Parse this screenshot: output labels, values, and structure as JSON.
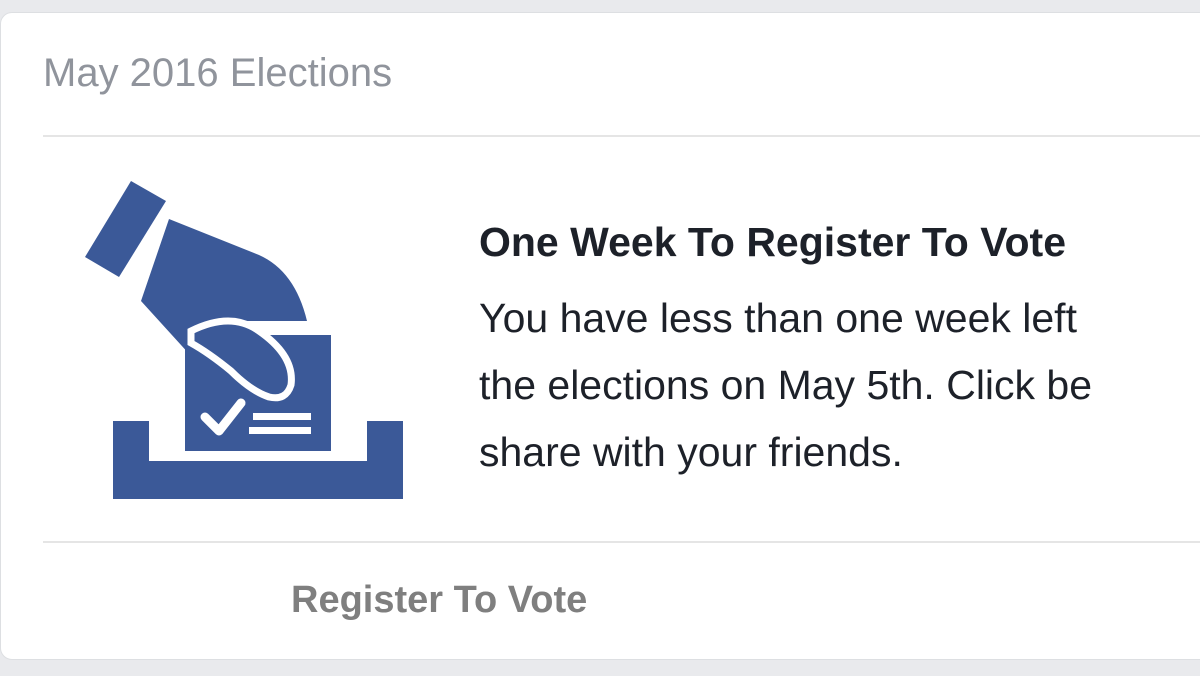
{
  "card": {
    "title": "May 2016 Elections"
  },
  "promo": {
    "icon": "ballot-box-icon",
    "title": "One Week To Register To Vote",
    "text_lines": [
      "You have less than one week left",
      "the elections on May 5th. Click be",
      "share with your friends."
    ]
  },
  "footer": {
    "action_label": "Register To Vote"
  },
  "colors": {
    "icon_blue": "#3b5998",
    "title_gray": "#90949c",
    "text": "#1d2129",
    "link_gray": "#7f7f7f"
  }
}
